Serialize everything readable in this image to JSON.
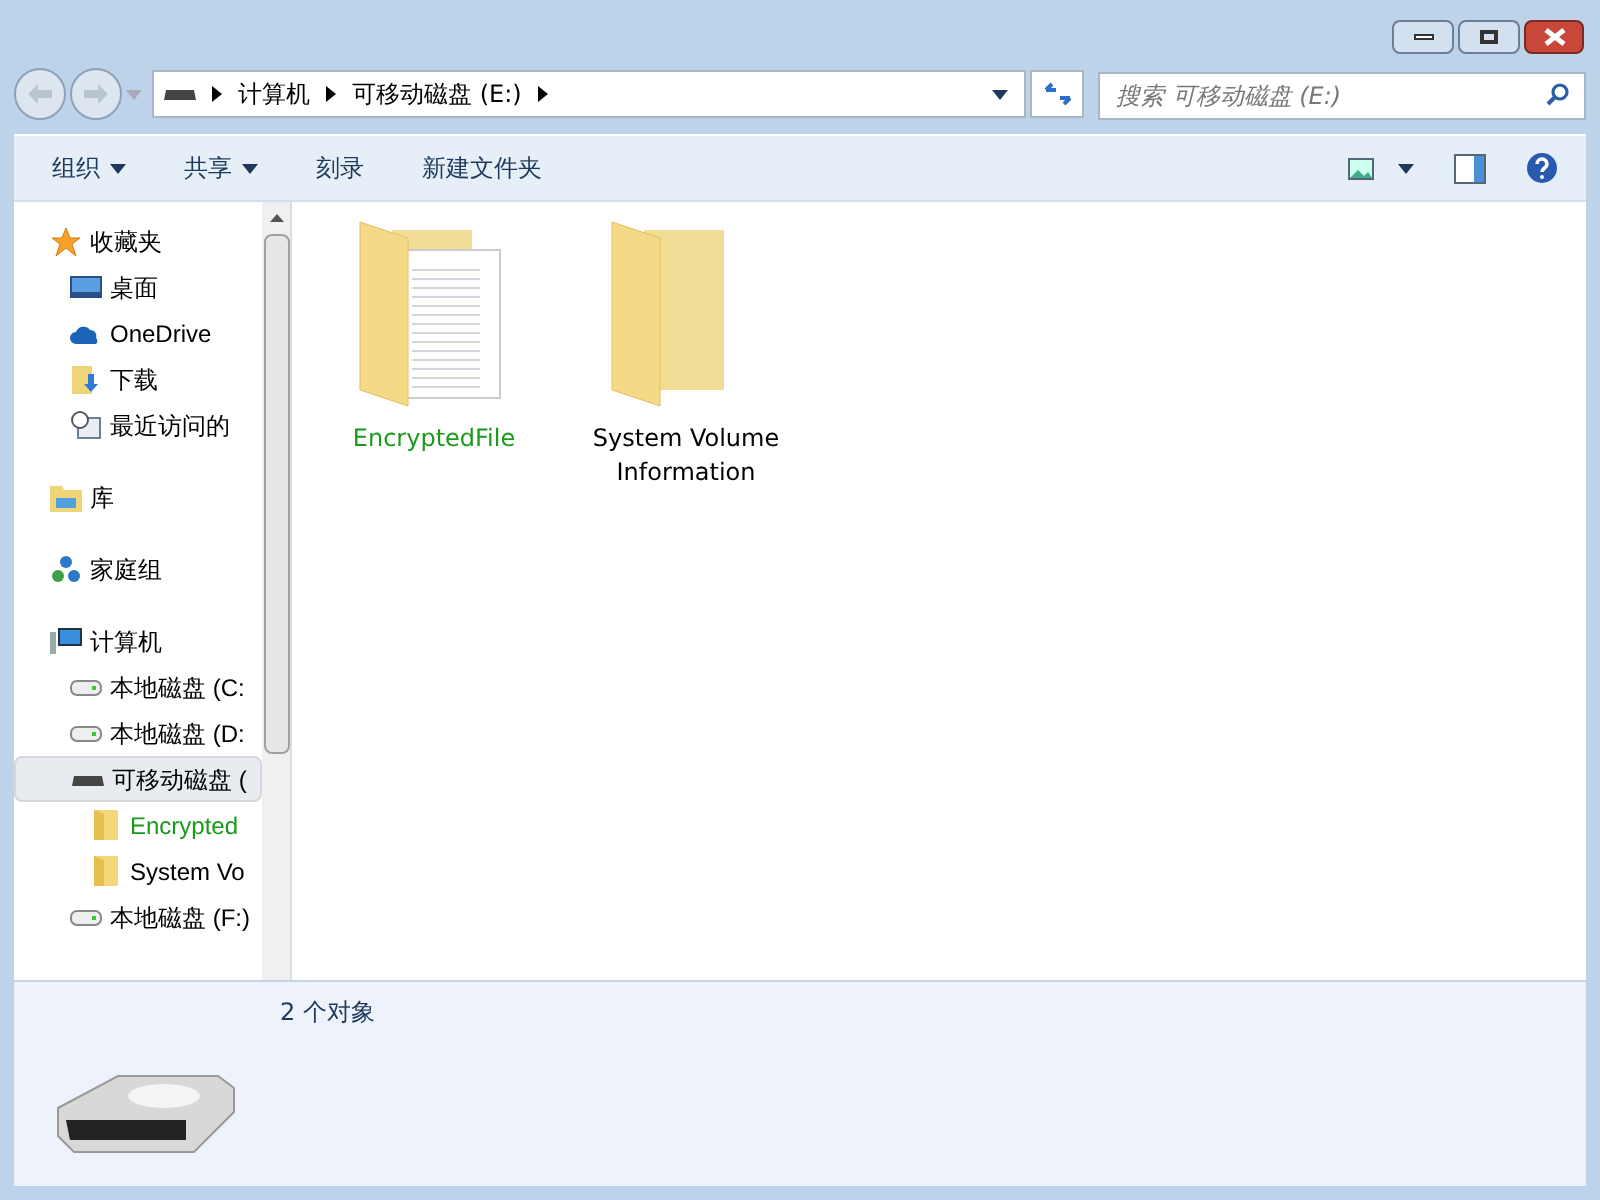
{
  "address": {
    "crumbs": [
      "计算机",
      "可移动磁盘 (E:)"
    ]
  },
  "search": {
    "placeholder": "搜索 可移动磁盘 (E:)"
  },
  "toolbar": [
    {
      "label": "组织",
      "dropdown": true
    },
    {
      "label": "共享",
      "dropdown": true
    },
    {
      "label": "刻录",
      "dropdown": false
    },
    {
      "label": "新建文件夹",
      "dropdown": false
    }
  ],
  "sidebar": {
    "items": [
      {
        "kind": "star",
        "label": "收藏夹",
        "selected": false,
        "children": [
          {
            "kind": "desktop",
            "label": "桌面",
            "selected": false
          },
          {
            "kind": "cloud",
            "label": "OneDrive",
            "selected": false
          },
          {
            "kind": "download",
            "label": "下载",
            "selected": false
          },
          {
            "kind": "recent",
            "label": "最近访问的",
            "selected": false
          }
        ]
      },
      {
        "kind": "library",
        "label": "库",
        "selected": false
      },
      {
        "kind": "homegroup",
        "label": "家庭组",
        "selected": false
      },
      {
        "kind": "computer",
        "label": "计算机",
        "selected": false,
        "children": [
          {
            "kind": "disk",
            "label": "本地磁盘 (C:",
            "selected": false
          },
          {
            "kind": "disk",
            "label": "本地磁盘 (D:",
            "selected": false
          },
          {
            "kind": "usb",
            "label": "可移动磁盘 (",
            "selected": true,
            "children": [
              {
                "kind": "folder",
                "label": "Encrypted",
                "selected": false,
                "encrypted": true
              },
              {
                "kind": "folder",
                "label": "System Vo",
                "selected": false,
                "encrypted": false
              }
            ]
          },
          {
            "kind": "disk",
            "label": "本地磁盘 (F:)",
            "selected": false
          }
        ]
      }
    ]
  },
  "files": [
    {
      "name": "EncryptedFile",
      "encrypted": true,
      "kind": "document"
    },
    {
      "name": "System Volume Information",
      "encrypted": false,
      "kind": "empty"
    }
  ],
  "details": {
    "count": "2 个对象"
  }
}
